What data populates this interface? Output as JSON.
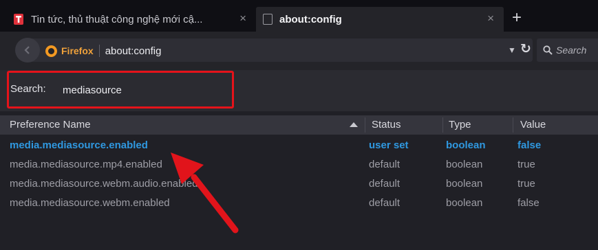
{
  "tabs": [
    {
      "title": "Tin tức, thủ thuật công nghệ mới cậ...",
      "close": "×"
    },
    {
      "title": "about:config",
      "close": "×"
    }
  ],
  "newtab": "+",
  "nav": {
    "brand": "Firefox",
    "url": "about:config",
    "search_placeholder": "Search"
  },
  "search": {
    "label": "Search:",
    "value": "mediasource"
  },
  "columns": [
    "Preference Name",
    "Status",
    "Type",
    "Value"
  ],
  "rows": [
    {
      "name": "media.mediasource.enabled",
      "status": "user set",
      "type": "boolean",
      "value": "false"
    },
    {
      "name": "media.mediasource.mp4.enabled",
      "status": "default",
      "type": "boolean",
      "value": "true"
    },
    {
      "name": "media.mediasource.webm.audio.enabled",
      "status": "default",
      "type": "boolean",
      "value": "true"
    },
    {
      "name": "media.mediasource.webm.enabled",
      "status": "default",
      "type": "boolean",
      "value": "false"
    }
  ],
  "colors": {
    "accent_user_set": "#2f98e0",
    "highlight": "#e5131a",
    "brand": "#f0a23b"
  },
  "icons": [
    "tab-favicon-icon",
    "page-icon",
    "back-arrow-icon",
    "firefox-logo-icon",
    "dropdown-icon",
    "reload-icon",
    "search-icon",
    "sort-ascending-icon"
  ]
}
